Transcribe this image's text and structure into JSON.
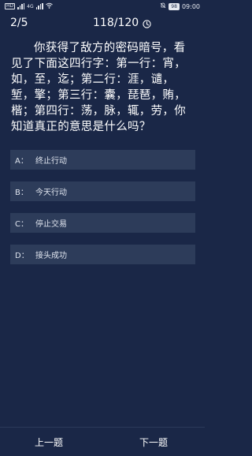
{
  "status_bar": {
    "time": "09:00",
    "battery": "98",
    "left_labels": [
      "HD",
      "4G"
    ]
  },
  "header": {
    "progress": "2/5",
    "timer": "118/120",
    "timer_icon": "clock-icon"
  },
  "question": {
    "text": "你获得了敌方的密码暗号，看见了下面这四行字：第一行：宵，如，至，迄；第二行：涯，谴，堑，擎；第三行：囊，琵琶，贿，楷；第四行：荡，脉，辄，劳，你知道真正的意思是什么吗？"
  },
  "options": [
    {
      "letter": "A：",
      "text": "终止行动"
    },
    {
      "letter": "B：",
      "text": "今天行动"
    },
    {
      "letter": "C：",
      "text": "停止交易"
    },
    {
      "letter": "D：",
      "text": "接头成功"
    }
  ],
  "nav": {
    "prev": "上一题",
    "next": "下一题"
  },
  "colors": {
    "background": "#1a2747",
    "option_bg": "#2d3c5a"
  }
}
